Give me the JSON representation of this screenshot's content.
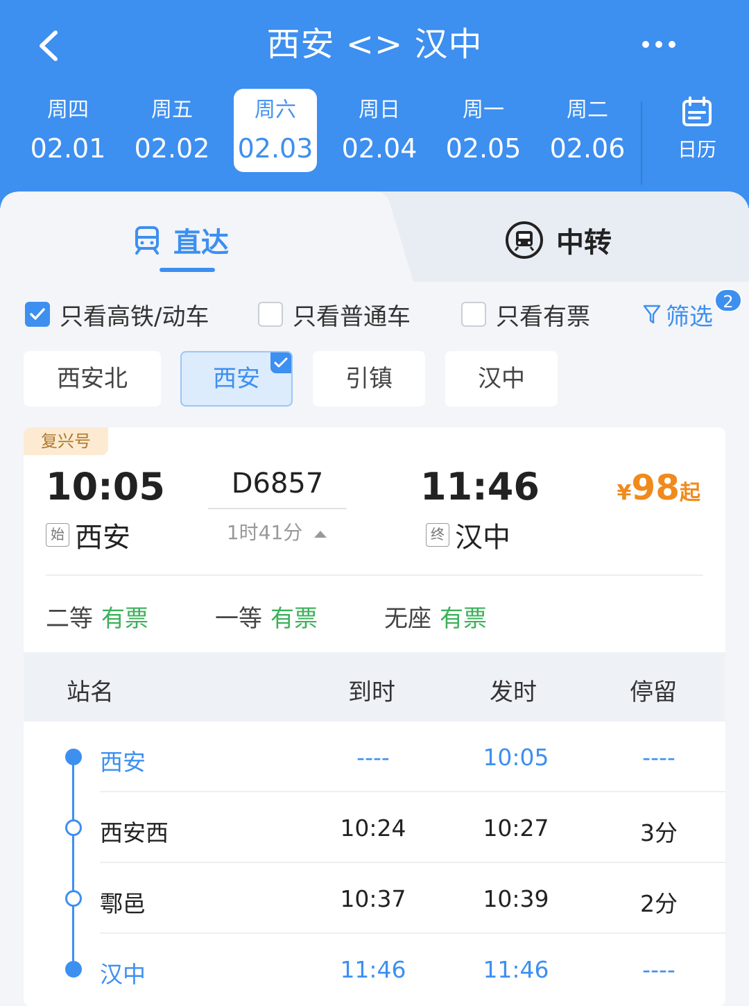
{
  "header": {
    "title": "西安 <> 汉中",
    "colors": {
      "primary": "#3d8ff0",
      "price": "#f08a1c",
      "available": "#3cb05a"
    }
  },
  "dates": [
    {
      "weekday": "周四",
      "date": "02.01",
      "active": false
    },
    {
      "weekday": "周五",
      "date": "02.02",
      "active": false
    },
    {
      "weekday": "周六",
      "date": "02.03",
      "active": true
    },
    {
      "weekday": "周日",
      "date": "02.04",
      "active": false
    },
    {
      "weekday": "周一",
      "date": "02.05",
      "active": false
    },
    {
      "weekday": "周二",
      "date": "02.06",
      "active": false
    }
  ],
  "calendar_label": "日历",
  "tabs": {
    "direct": "直达",
    "transfer": "中转"
  },
  "filters": {
    "high_speed": {
      "label": "只看高铁/动车",
      "checked": true
    },
    "normal": {
      "label": "只看普通车",
      "checked": false
    },
    "available": {
      "label": "只看有票",
      "checked": false
    },
    "filter_label": "筛选",
    "filter_count": "2"
  },
  "stations": [
    {
      "name": "西安北",
      "selected": false
    },
    {
      "name": "西安",
      "selected": true
    },
    {
      "name": "引镇",
      "selected": false
    },
    {
      "name": "汉中",
      "selected": false
    }
  ],
  "train": {
    "brand": "复兴号",
    "depart_time": "10:05",
    "depart_tag": "始",
    "depart_station": "西安",
    "number": "D6857",
    "duration": "1时41分",
    "arrive_time": "11:46",
    "arrive_tag": "终",
    "arrive_station": "汉中",
    "price_currency": "¥",
    "price_amount": "98",
    "price_suffix": "起",
    "seats": [
      {
        "class": "二等",
        "status": "有票"
      },
      {
        "class": "一等",
        "status": "有票"
      },
      {
        "class": "无座",
        "status": "有票"
      }
    ]
  },
  "stops_header": {
    "name": "站名",
    "arrive": "到时",
    "depart": "发时",
    "stay": "停留"
  },
  "stops": [
    {
      "name": "西安",
      "arrive": "----",
      "depart": "10:05",
      "stay": "----",
      "highlight": true
    },
    {
      "name": "西安西",
      "arrive": "10:24",
      "depart": "10:27",
      "stay": "3分",
      "highlight": false
    },
    {
      "name": "鄠邑",
      "arrive": "10:37",
      "depart": "10:39",
      "stay": "2分",
      "highlight": false
    },
    {
      "name": "汉中",
      "arrive": "11:46",
      "depart": "11:46",
      "stay": "----",
      "highlight": true
    }
  ]
}
